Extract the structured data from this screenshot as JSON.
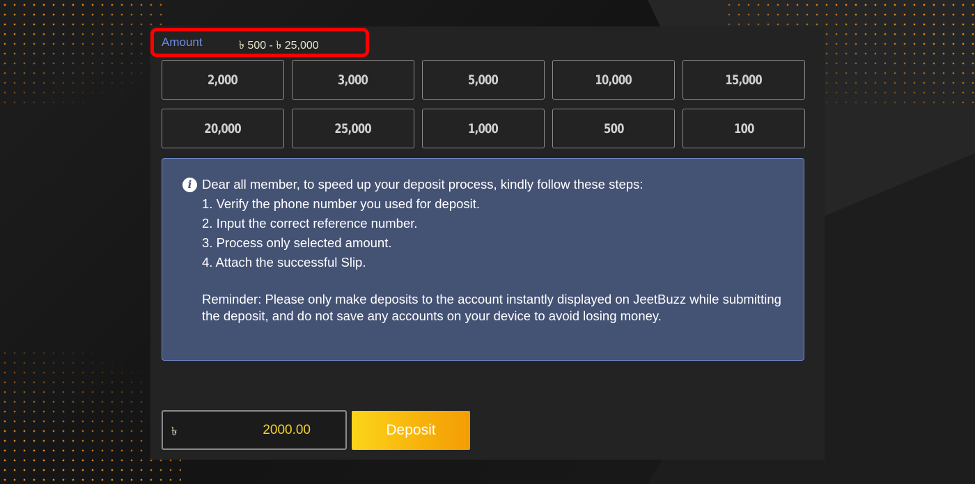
{
  "amount": {
    "label": "Amount",
    "range": "৳ 500 - ৳ 25,000"
  },
  "quick_amounts": [
    "2,000",
    "3,000",
    "5,000",
    "10,000",
    "15,000",
    "20,000",
    "25,000",
    "1,000",
    "500",
    "100"
  ],
  "notice": {
    "icon": "info-icon",
    "heading": "Dear all member, to speed up your deposit process, kindly follow these steps:",
    "steps": [
      "1. Verify the phone number you used for deposit.",
      "2. Input the correct reference number.",
      "3. Process only selected amount.",
      "4. Attach the successful Slip."
    ],
    "reminder": "Reminder: Please only make deposits to the account instantly displayed on JeetBuzz while submitting the deposit, and do not save any accounts on your device to avoid losing money."
  },
  "input": {
    "currency": "৳",
    "value": "2000.00"
  },
  "deposit_label": "Deposit",
  "colors": {
    "accent_highlight": "#ff0000",
    "notice_bg": "#445274",
    "button_gradient_start": "#fbd51a",
    "button_gradient_end": "#f49d06",
    "amount_value": "#f3d22a",
    "label_blue": "#6b8ee8"
  }
}
